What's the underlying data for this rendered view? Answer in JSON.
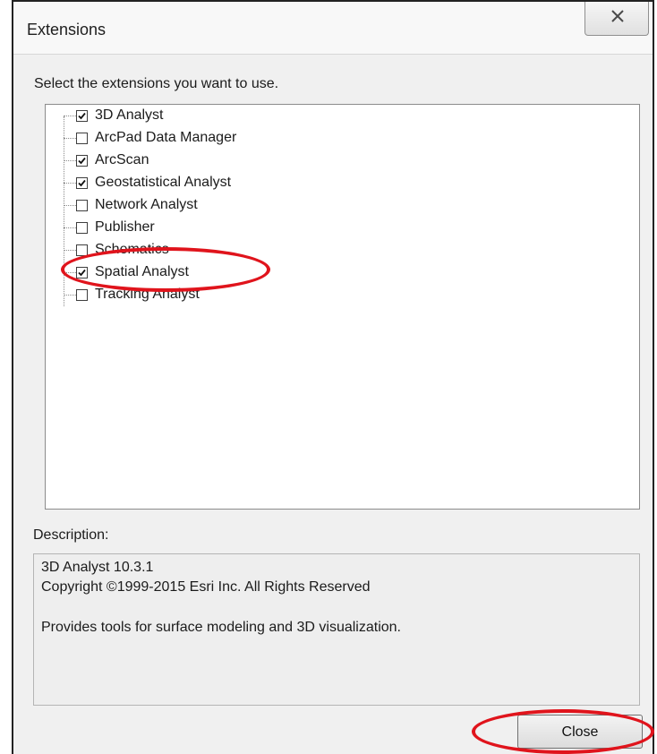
{
  "window": {
    "title": "Extensions",
    "close_icon": "close-x-icon"
  },
  "prompt": "Select the extensions you want to use.",
  "extensions": [
    {
      "label": "3D Analyst",
      "checked": true
    },
    {
      "label": "ArcPad Data Manager",
      "checked": false
    },
    {
      "label": "ArcScan",
      "checked": true
    },
    {
      "label": "Geostatistical Analyst",
      "checked": true
    },
    {
      "label": "Network Analyst",
      "checked": false
    },
    {
      "label": "Publisher",
      "checked": false
    },
    {
      "label": "Schematics",
      "checked": false
    },
    {
      "label": "Spatial Analyst",
      "checked": true
    },
    {
      "label": "Tracking Analyst",
      "checked": false
    }
  ],
  "description": {
    "label": "Description:",
    "line1": "3D Analyst 10.3.1",
    "line2": "Copyright ©1999-2015 Esri Inc. All Rights Reserved",
    "line3": "Provides tools for surface modeling and 3D visualization."
  },
  "buttons": {
    "close": "Close"
  },
  "annotation_color": "#e0141c"
}
